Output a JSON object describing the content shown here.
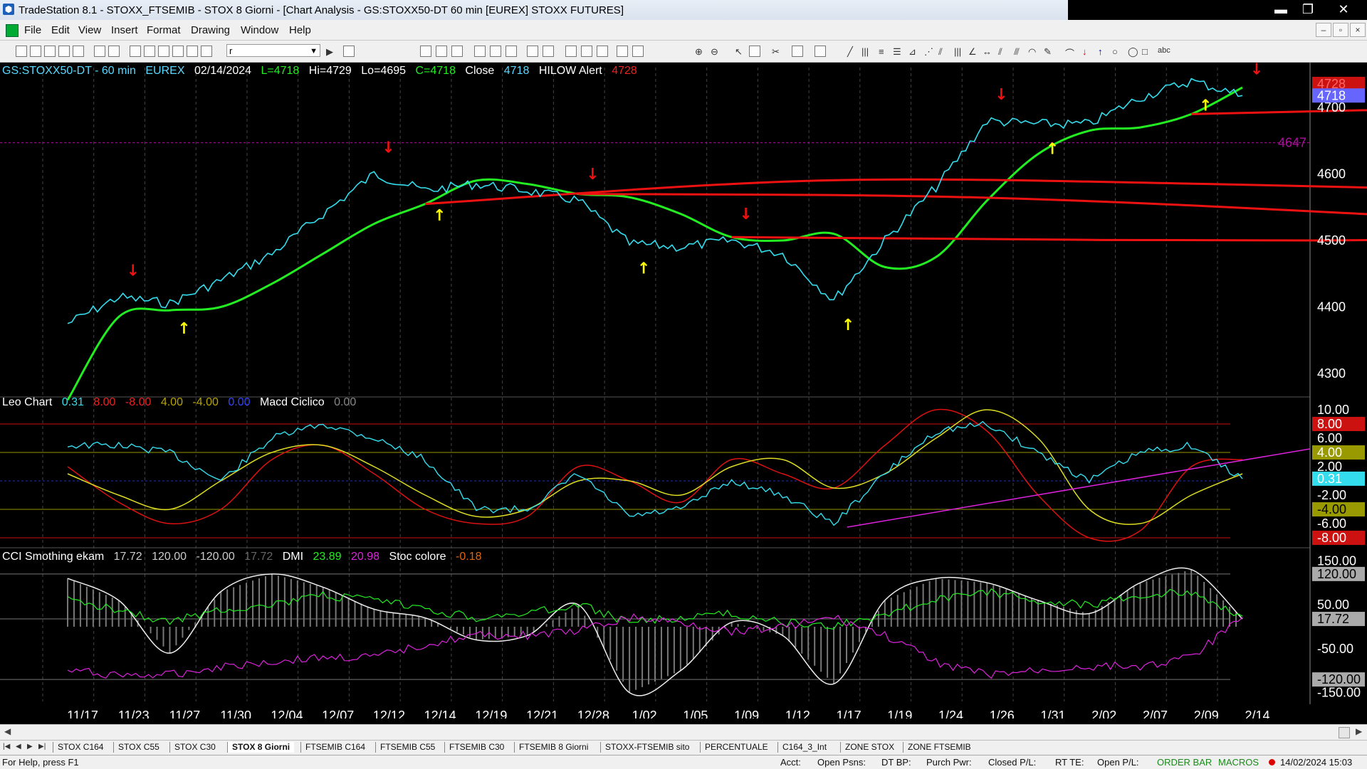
{
  "window": {
    "title": "TradeStation 8.1 - STOXX_FTSEMIB - STOX  8 Giorni - [Chart Analysis - GS:STOXX50-DT  60 min  [EUREX] STOXX FUTURES]",
    "min_label": "▬",
    "max_label": "❐",
    "close_label": "✕"
  },
  "menu": {
    "items": [
      "File",
      "Edit",
      "View",
      "Insert",
      "Format",
      "Drawing",
      "Window",
      "Help"
    ],
    "mdi_min": "–",
    "mdi_restore": "▫",
    "mdi_close": "×"
  },
  "toolbar": {
    "symbol_value": "r",
    "abc_label": "abc"
  },
  "price_panel": {
    "header": {
      "symbol": "GS:STOXX50-DT - 60 min",
      "exchange": "EUREX",
      "date": "02/14/2024",
      "last": "L=4718",
      "high": "Hi=4729",
      "low": "Lo=4695",
      "close": "C=4718",
      "close_label": "Close",
      "close_value": "4718",
      "alert_label": "HILOW Alert",
      "alert_value": "4728"
    },
    "axis_labels": [
      "4700",
      "4600",
      "4500",
      "4400",
      "4300"
    ],
    "hline_value": "4647",
    "last_tag": "4718",
    "overlap_tag": "4728"
  },
  "osc_panel": {
    "header": {
      "name": "Leo Chart",
      "v1": "0.31",
      "v2": "8.00",
      "v3": "-8.00",
      "v4": "4.00",
      "v5": "-4.00",
      "v6": "0.00",
      "name2": "Macd Ciclico",
      "v7": "0.00"
    },
    "axis_labels": [
      "10.00",
      "6.00",
      "2.00",
      "-2.00",
      "-6.00"
    ],
    "tags": {
      "t_red_top": "8.00",
      "t_yel_top": "4.00",
      "t_cyan": "0.31",
      "t_yel_bot": "-4.00",
      "t_red_bot": "-8.00"
    }
  },
  "cci_panel": {
    "header": {
      "name": "CCI Smothing ekam",
      "v1": "17.72",
      "v2": "120.00",
      "v3": "-120.00",
      "v4": "17.72",
      "name2": "DMI",
      "v5": "23.89",
      "v6": "20.98",
      "name3": "Stoc colore",
      "v7": "-0.18"
    },
    "axis_labels": [
      "150.00",
      "50.00",
      "-50.00",
      "-150.00"
    ],
    "tags": {
      "t_top": "120.00",
      "t_mid": "17.72",
      "t_bot": "-120.00"
    }
  },
  "time_axis": [
    "11/17",
    "11/23",
    "11/27",
    "11/30",
    "12/04",
    "12/07",
    "12/12",
    "12/14",
    "12/19",
    "12/21",
    "12/28",
    "1/02",
    "1/05",
    "1/09",
    "1/12",
    "1/17",
    "1/19",
    "1/24",
    "1/26",
    "1/31",
    "2/02",
    "2/07",
    "2/09",
    "2/14"
  ],
  "tabs": {
    "nav": [
      "|◀",
      "◀",
      "▶",
      "▶|"
    ],
    "items": [
      "STOX C164",
      "STOX C55",
      "STOX  C30",
      "STOX  8 Giorni",
      "FTSEMIB C164",
      "FTSEMIB C55",
      "FTSEMIB C30",
      "FTSEMIB  8 Giorni",
      "STOXX-FTSEMIB sito",
      "PERCENTUALE",
      "C164_3_Int",
      "ZONE STOX",
      "ZONE FTSEMIB"
    ],
    "active_index": 3
  },
  "status": {
    "help": "For Help, press F1",
    "acct": "Acct:",
    "open_psns": "Open Psns:",
    "dt_bp": "DT BP:",
    "purch_pwr": "Purch Pwr:",
    "closed_pl": "Closed P/L:",
    "rt_te": "RT TE:",
    "open_pl": "Open P/L:",
    "order_bar": "ORDER BAR",
    "macros": "MACROS",
    "datetime": "14/02/2024 15:03"
  },
  "colors": {
    "price_line": "#33ddee",
    "ma_green": "#22ee22",
    "ma_red": "#ee1111",
    "sell_arrow": "#ee1111",
    "buy_arrow": "#ffff00",
    "magenta": "#dd22dd",
    "axis_text": "#ffffff"
  },
  "chart_data": [
    {
      "type": "line",
      "panel": "price",
      "title": "GS:STOXX50-DT - 60 min",
      "x": [
        "11/17",
        "11/23",
        "11/27",
        "11/30",
        "12/04",
        "12/07",
        "12/12",
        "12/14",
        "12/19",
        "12/21",
        "12/28",
        "1/02",
        "1/05",
        "1/09",
        "1/12",
        "1/17",
        "1/19",
        "1/24",
        "1/26",
        "1/31",
        "2/02",
        "2/07",
        "2/09",
        "2/14"
      ],
      "ylim": [
        4270,
        4760
      ],
      "series": [
        {
          "name": "Close",
          "values": [
            4375,
            4415,
            4405,
            4440,
            4480,
            4540,
            4600,
            4575,
            4585,
            4575,
            4560,
            4495,
            4490,
            4500,
            4480,
            4410,
            4500,
            4580,
            4680,
            4675,
            4675,
            4715,
            4740,
            4718
          ]
        },
        {
          "values": [
            4260,
            4385,
            4395,
            4400,
            4435,
            4480,
            4525,
            4555,
            4590,
            4585,
            4570,
            4565,
            4540,
            4505,
            4500,
            4510,
            4460,
            4475,
            4560,
            4630,
            4665,
            4670,
            4690,
            4730
          ]
        }
      ],
      "arrows": {
        "sell_dates": [
          "11/23",
          "12/12",
          "12/28",
          "1/09",
          "1/26",
          "2/14"
        ],
        "buy_dates": [
          "11/27",
          "12/14",
          "1/02",
          "1/17",
          "1/31",
          "2/09"
        ]
      },
      "hlines": [
        4647
      ]
    },
    {
      "type": "line",
      "panel": "oscillator",
      "title": "Leo Chart",
      "x": [
        "11/17",
        "11/23",
        "11/27",
        "11/30",
        "12/04",
        "12/07",
        "12/12",
        "12/14",
        "12/19",
        "12/21",
        "12/28",
        "1/02",
        "1/05",
        "1/09",
        "1/12",
        "1/17",
        "1/19",
        "1/24",
        "1/26",
        "1/31",
        "2/02",
        "2/07",
        "2/09",
        "2/14"
      ],
      "ylim": [
        -9,
        11
      ],
      "hlines": [
        8,
        4,
        0,
        -4,
        -8
      ],
      "series": [
        {
          "name": "Leo Chart",
          "values": [
            5,
            5,
            4,
            0,
            6,
            8,
            6,
            3,
            -4,
            -4,
            1,
            -5,
            -4,
            0,
            -2,
            -6,
            1,
            7,
            8,
            4,
            0,
            4,
            5,
            0.31
          ]
        },
        {
          "name": "Macd Ciclico",
          "values": [
            1,
            -2,
            -4,
            0,
            4,
            5,
            2,
            -2,
            -5,
            -4,
            0,
            0,
            -2,
            2,
            3,
            -1,
            1,
            6,
            10,
            6,
            -4,
            -6,
            -2,
            1
          ]
        },
        {
          "values": [
            2,
            -3,
            -6,
            -4,
            3,
            5,
            1,
            -4,
            -6,
            -5,
            2,
            0,
            -3,
            3,
            1,
            -1,
            5,
            10,
            7,
            -2,
            -8,
            -7,
            2,
            3
          ]
        }
      ]
    },
    {
      "type": "line",
      "panel": "cci",
      "title": "CCI Smothing ekam",
      "x": [
        "11/17",
        "11/23",
        "11/27",
        "11/30",
        "12/04",
        "12/07",
        "12/12",
        "12/14",
        "12/19",
        "12/21",
        "12/28",
        "1/02",
        "1/05",
        "1/09",
        "1/12",
        "1/17",
        "1/19",
        "1/24",
        "1/26",
        "1/31",
        "2/02",
        "2/07",
        "2/09",
        "2/14"
      ],
      "ylim": [
        -170,
        170
      ],
      "hlines": [
        120,
        17.72,
        -120
      ],
      "series": [
        {
          "name": "CCI Smothing ekam",
          "values": [
            110,
            60,
            -60,
            80,
            120,
            90,
            40,
            20,
            -30,
            -20,
            50,
            -150,
            -100,
            10,
            -20,
            -130,
            60,
            110,
            100,
            60,
            30,
            100,
            130,
            17.72
          ]
        },
        {
          "name": "DMI",
          "values": [
            60,
            40,
            10,
            40,
            50,
            70,
            60,
            40,
            20,
            30,
            50,
            10,
            20,
            30,
            10,
            0,
            30,
            60,
            80,
            60,
            50,
            70,
            80,
            23.89
          ]
        },
        {
          "values": [
            -100,
            -110,
            -110,
            -90,
            -80,
            -70,
            -70,
            -40,
            -20,
            -20,
            -10,
            20,
            10,
            -10,
            0,
            20,
            -20,
            -80,
            -110,
            -100,
            -90,
            -90,
            -70,
            20.98
          ]
        }
      ]
    }
  ]
}
